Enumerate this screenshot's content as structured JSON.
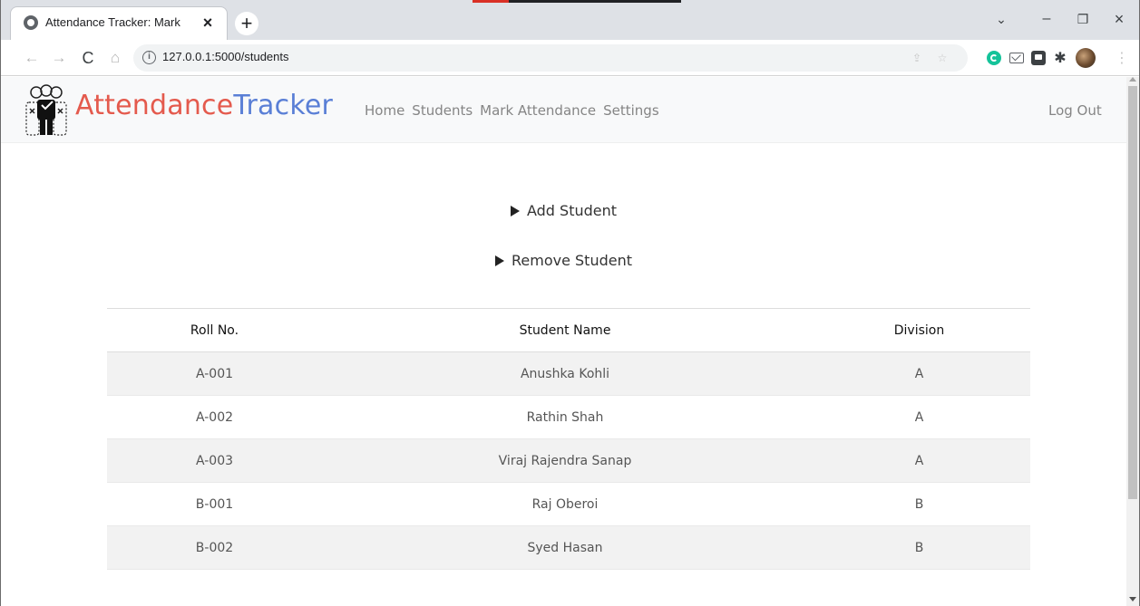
{
  "browser": {
    "tab_title": "Attendance Tracker: Mark",
    "tab_close": "×",
    "new_tab": "+",
    "url": "127.0.0.1:5000/students",
    "window_controls": {
      "minimize": "–",
      "maximize": "❐",
      "close": "×",
      "collapse": "⌄"
    },
    "nav": {
      "back": "←",
      "forward": "→",
      "reload": "C",
      "home": "⌂"
    }
  },
  "navbar": {
    "brand_first": "Attendance",
    "brand_second": "Tracker",
    "brand_colors": {
      "first": "#e45a4d",
      "second": "#5a7fd6"
    },
    "links": [
      "Home",
      "Students",
      "Mark Attendance",
      "Settings"
    ],
    "logout": "Log Out"
  },
  "actions": {
    "add_student": "Add Student",
    "remove_student": "Remove Student"
  },
  "table": {
    "headers": {
      "roll": "Roll No.",
      "name": "Student Name",
      "division": "Division"
    },
    "rows": [
      {
        "roll": "A-001",
        "name": "Anushka Kohli",
        "division": "A"
      },
      {
        "roll": "A-002",
        "name": "Rathin Shah",
        "division": "A"
      },
      {
        "roll": "A-003",
        "name": "Viraj Rajendra Sanap",
        "division": "A"
      },
      {
        "roll": "B-001",
        "name": "Raj Oberoi",
        "division": "B"
      },
      {
        "roll": "B-002",
        "name": "Syed Hasan",
        "division": "B"
      }
    ]
  }
}
